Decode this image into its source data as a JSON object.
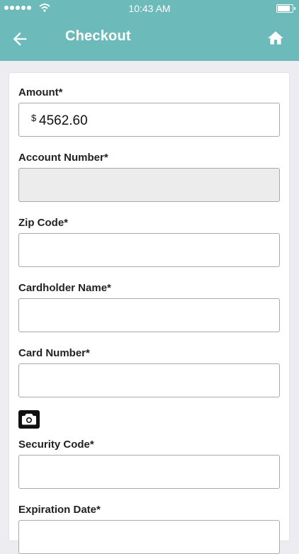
{
  "status_bar": {
    "time": "10:43 AM"
  },
  "nav": {
    "title": "Checkout",
    "back_icon": "arrow-left-icon",
    "home_icon": "home-icon"
  },
  "colors": {
    "header": "#6cbaba",
    "background": "#ececf1"
  },
  "form": {
    "amount": {
      "label": "Amount*",
      "currency": "$",
      "value": "4562.60"
    },
    "account_number": {
      "label": "Account Number*",
      "value": ""
    },
    "zip_code": {
      "label": "Zip Code*",
      "value": ""
    },
    "cardholder_name": {
      "label": "Cardholder Name*",
      "value": ""
    },
    "card_number": {
      "label": "Card Number*",
      "value": "",
      "scan_icon": "camera-icon"
    },
    "security_code": {
      "label": "Security Code*",
      "value": ""
    },
    "expiration_date": {
      "label": "Expiration Date*",
      "value": ""
    }
  }
}
